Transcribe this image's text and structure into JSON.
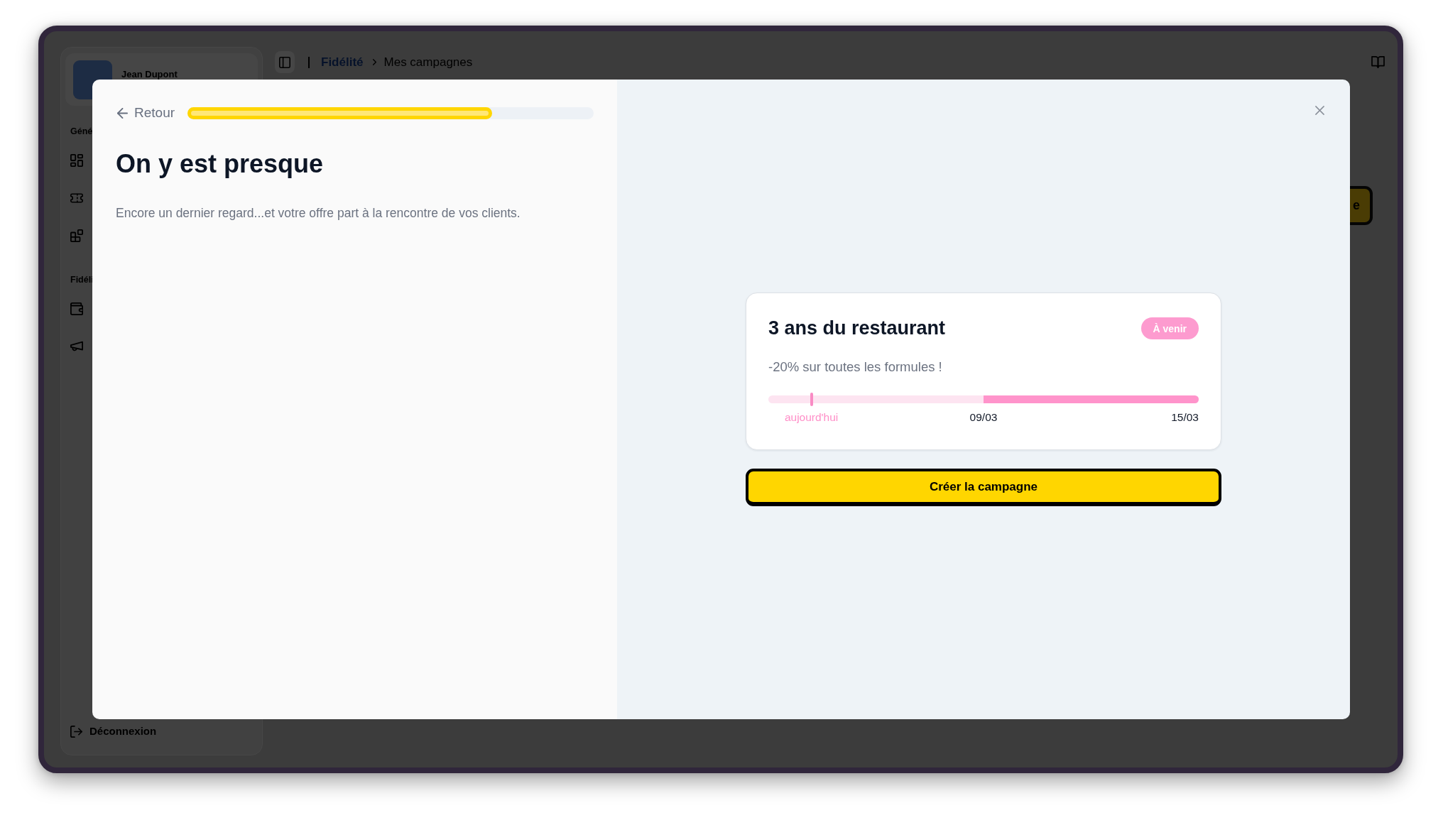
{
  "sidebar": {
    "user": {
      "name": "Jean Dupont"
    },
    "sections": [
      {
        "label": "Géné"
      },
      {
        "label": "Fidéli"
      }
    ],
    "logout": {
      "label": "Déconnexion"
    }
  },
  "header": {
    "breadcrumb": [
      {
        "label": "Fidélité",
        "current": false
      },
      {
        "label": "Mes campagnes",
        "current": true
      }
    ]
  },
  "page_button": {
    "label": "e"
  },
  "modal": {
    "back": {
      "label": "Retour"
    },
    "progress": {
      "level": 0.75
    },
    "title": "On y est presque",
    "subtitle": "Encore un dernier regard...et votre offre part à la rencontre de vos clients.",
    "preview_card": {
      "title": "3 ans du restaurant",
      "status": {
        "label": "À venir"
      },
      "description": "-20% sur toutes les formules !",
      "timeline": {
        "today": {
          "label": "aujourd'hui",
          "level": 0.1
        },
        "start": {
          "label": "09/03",
          "level": 0.5
        },
        "end": {
          "label": "15/03"
        }
      }
    },
    "submit": {
      "label": "Créer la campagne"
    }
  }
}
